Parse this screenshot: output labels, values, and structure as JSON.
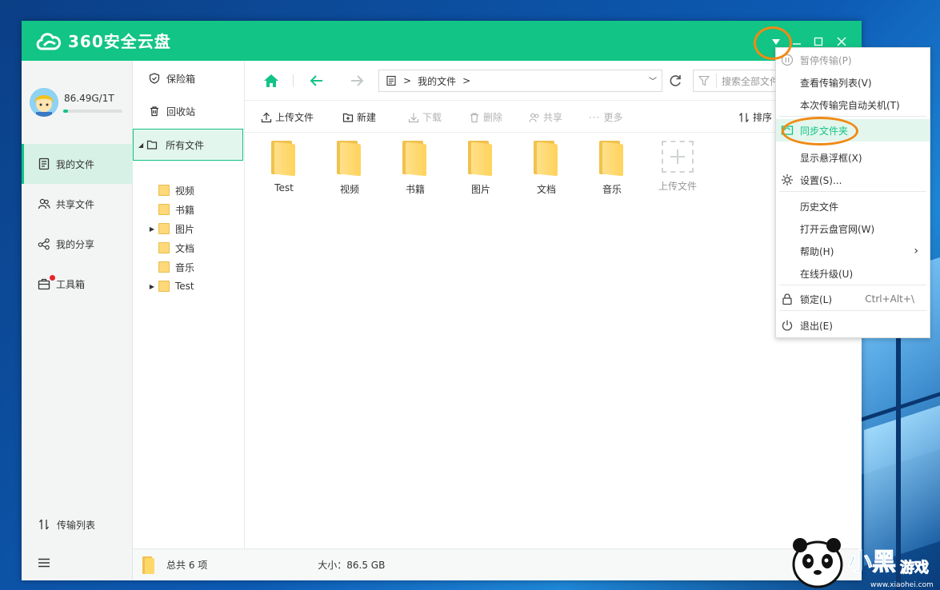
{
  "app": {
    "title": "360安全云盘",
    "brand_color": "#12c485"
  },
  "account": {
    "quota": "86.49G/1T",
    "quota_used_fraction": 0.0845
  },
  "left_nav": {
    "items": [
      {
        "label": "我的文件",
        "icon": "document-icon",
        "active": true
      },
      {
        "label": "共享文件",
        "icon": "users-icon",
        "active": false
      },
      {
        "label": "我的分享",
        "icon": "share-icon",
        "active": false
      },
      {
        "label": "工具箱",
        "icon": "toolbox-icon",
        "active": false,
        "badge": "red-dot"
      }
    ],
    "transfer_list": "传输列表"
  },
  "tree": {
    "top": [
      {
        "label": "保险箱"
      },
      {
        "label": "回收站"
      }
    ],
    "all_files": "所有文件",
    "folders": [
      {
        "label": "视频",
        "expandable": false
      },
      {
        "label": "书籍",
        "expandable": false
      },
      {
        "label": "图片",
        "expandable": true
      },
      {
        "label": "文档",
        "expandable": false
      },
      {
        "label": "音乐",
        "expandable": false
      },
      {
        "label": "Test",
        "expandable": true
      }
    ]
  },
  "navbar": {
    "path_separator": ">",
    "path": "我的文件",
    "search_placeholder": "搜索全部文件"
  },
  "toolbar": {
    "upload": "上传文件",
    "new": "新建",
    "download": "下载",
    "delete": "删除",
    "share": "共享",
    "more": "更多",
    "sort": "排序"
  },
  "files": [
    {
      "name": "Test",
      "type": "folder-with-files"
    },
    {
      "name": "视频",
      "type": "folder"
    },
    {
      "name": "书籍",
      "type": "folder"
    },
    {
      "name": "图片",
      "type": "folder-with-files"
    },
    {
      "name": "文档",
      "type": "folder"
    },
    {
      "name": "音乐",
      "type": "folder"
    }
  ],
  "upload_tile": "上传文件",
  "status": {
    "total": "总共 6 项",
    "size": "大小：86.5 GB"
  },
  "menu": {
    "items": [
      {
        "label": "暂停传输(P)",
        "disabled": true,
        "icon": "pause-icon"
      },
      {
        "label": "查看传输列表(V)"
      },
      {
        "label": "本次传输完自动关机(T)"
      },
      {
        "label": "同步文件夹",
        "highlighted": true,
        "icon": "sync-folder-icon"
      },
      {
        "label": "显示悬浮框(X)"
      },
      {
        "label": "设置(S)...",
        "icon": "gear-icon"
      },
      {
        "label": "历史文件"
      },
      {
        "label": "打开云盘官网(W)"
      },
      {
        "label": "帮助(H)",
        "submenu": true
      },
      {
        "label": "在线升级(U)"
      },
      {
        "label": "锁定(L)",
        "shortcut": "Ctrl+Alt+\\",
        "icon": "lock-icon"
      },
      {
        "label": "退出(E)",
        "icon": "power-icon"
      }
    ]
  },
  "watermark": {
    "brand": "小黑游戏",
    "url": "www.xiaohei.com"
  }
}
